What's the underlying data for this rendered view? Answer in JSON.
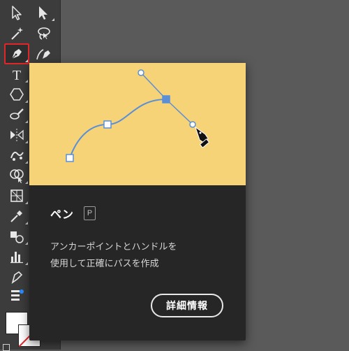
{
  "toolbar": {
    "tools": [
      {
        "name": "selection-tool-icon"
      },
      {
        "name": "direct-selection-tool-icon"
      },
      {
        "name": "magic-wand-tool-icon"
      },
      {
        "name": "lasso-tool-icon"
      },
      {
        "name": "pen-tool-icon",
        "selected": true
      },
      {
        "name": "curvature-tool-icon"
      },
      {
        "name": "type-tool-icon"
      },
      {
        "name": "polygon-tool-icon"
      },
      {
        "name": "paintbrush-tool-icon"
      },
      {
        "name": "reflect-tool-icon"
      },
      {
        "name": "puppet-warp-tool-icon"
      },
      {
        "name": "shape-builder-tool-icon"
      },
      {
        "name": "perspective-grid-tool-icon"
      },
      {
        "name": "mesh-tool-icon"
      },
      {
        "name": "blend-tool-icon"
      },
      {
        "name": "column-graph-tool-icon"
      },
      {
        "name": "eyedropper-tool-icon"
      },
      {
        "name": "artboard-tool-icon"
      }
    ],
    "type_glyph": "T"
  },
  "tooltip": {
    "title": "ペン",
    "shortcut": "P",
    "description_line1": "アンカーポイントとハンドルを",
    "description_line2": "使用して正確にパスを作成",
    "details_button": "詳細情報",
    "preview_background": "#f7d377",
    "path_color": "#5b8fd6"
  },
  "colors": {
    "selected_outline": "#e0262a",
    "toolbar_bg": "#3c3c3c",
    "canvas_bg": "#5a5a5a"
  }
}
